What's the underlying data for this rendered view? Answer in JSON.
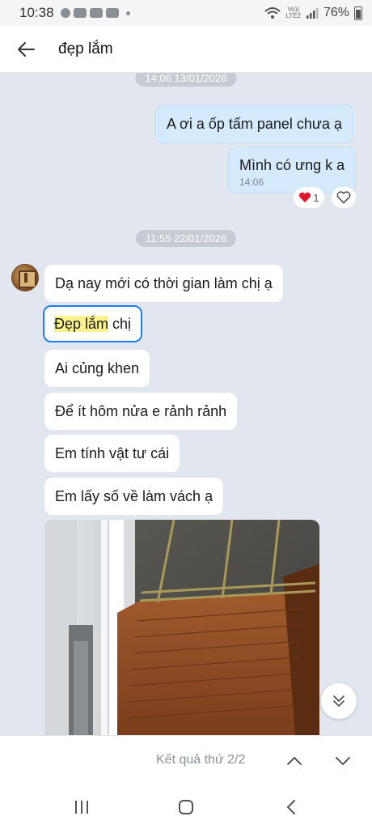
{
  "status_bar": {
    "time": "10:38",
    "network_label": "Vo))\nLTE2",
    "battery": "76%",
    "notification_icons": [
      "messenger-icon",
      "zalo-icon",
      "zalo-icon",
      "zalo-icon"
    ]
  },
  "header": {
    "title": "đẹp lắm"
  },
  "chat": {
    "date_separators": [
      "14:06 13/01/2026",
      "11:55 22/01/2026"
    ],
    "sent_messages": [
      {
        "text": "A ơi a ốp tấm panel chưa ạ",
        "time": ""
      },
      {
        "text": "Mình có ưng k a",
        "time": "14:06"
      }
    ],
    "reaction": {
      "emoji": "heart-icon",
      "count": "1"
    },
    "received_messages": [
      {
        "text": "Dạ nay mới có thời gian làm chị ạ"
      },
      {
        "highlighted": "Đẹp lắm",
        "rest": " chị"
      },
      {
        "text": "Ai củng khen"
      },
      {
        "text": "Để ít hôm nửa e rảnh rảnh"
      },
      {
        "text": "Em tính vật tư cái"
      },
      {
        "text": "Em lấy số về làm vách ạ"
      }
    ]
  },
  "search_nav": {
    "result_text": "Kết quả thứ 2/2"
  },
  "colors": {
    "chat_background": "#e2e7ef",
    "sent_bubble": "#d5ebfd",
    "highlight": "#fbf28d",
    "selection_border": "#1f7ff0"
  }
}
